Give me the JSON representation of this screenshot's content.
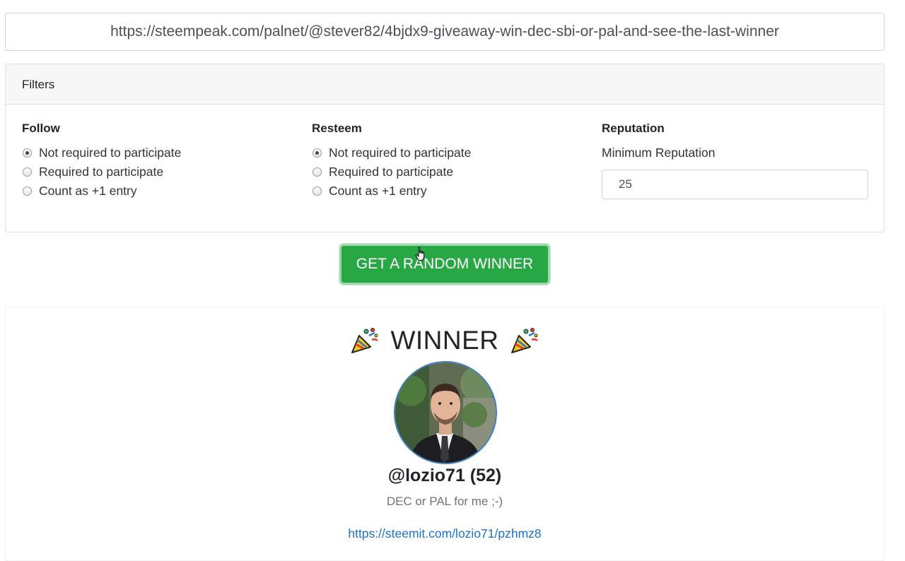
{
  "post_url": "https://steempeak.com/palnet/@stever82/4bjdx9-giveaway-win-dec-sbi-or-pal-and-see-the-last-winner",
  "filters": {
    "header": "Filters",
    "follow": {
      "title": "Follow",
      "options": [
        "Not required to participate",
        "Required to participate",
        "Count as +1 entry"
      ],
      "selected_index": 0
    },
    "resteem": {
      "title": "Resteem",
      "options": [
        "Not required to participate",
        "Required to participate",
        "Count as +1 entry"
      ],
      "selected_index": 0
    },
    "reputation": {
      "title": "Reputation",
      "min_label": "Minimum Reputation",
      "min_value": "25"
    }
  },
  "action_button": "GET A RANDOM WINNER",
  "winner": {
    "title": "WINNER",
    "icon": "party-popper-icon",
    "name": "@lozio71 (52)",
    "comment": "DEC or PAL for me ;-)",
    "link": "https://steemit.com/lozio71/pzhmz8"
  },
  "colors": {
    "button_green": "#28a745",
    "link_blue": "#1a73c8",
    "avatar_border": "#3b7fc4"
  }
}
